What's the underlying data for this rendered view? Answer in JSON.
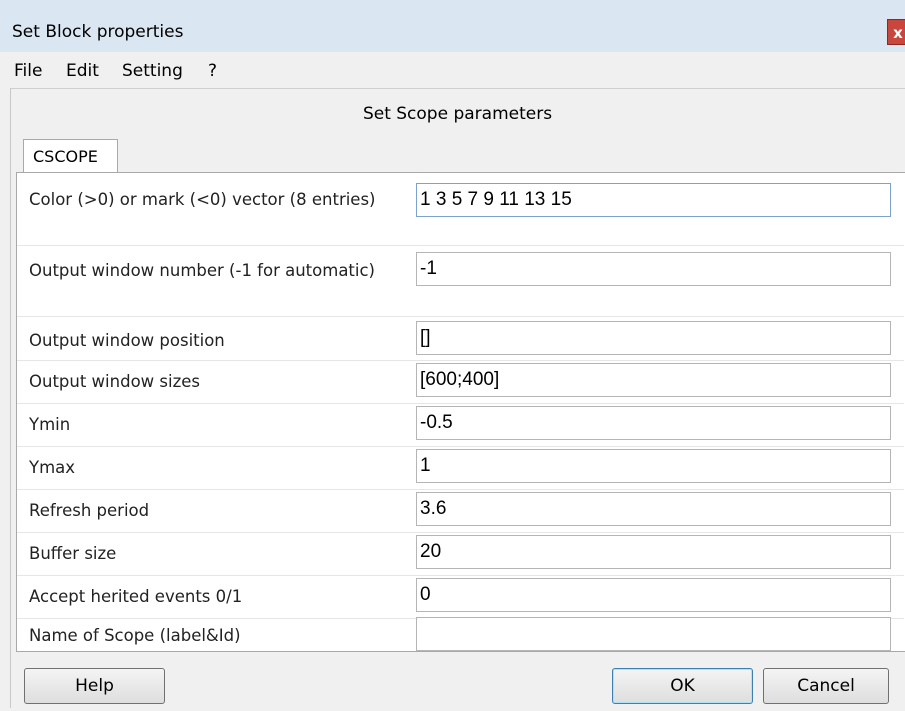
{
  "window": {
    "title": "Set Block properties",
    "close_glyph": "x"
  },
  "menu": [
    "File",
    "Edit",
    "Setting",
    "?"
  ],
  "header": "Set Scope parameters",
  "tab": "CSCOPE",
  "fields": [
    {
      "label": "Color (>0) or mark (<0) vector (8 entries)",
      "value": "1 3 5 7 9 11 13 15"
    },
    {
      "label": "Output window number (-1 for automatic)",
      "value": "-1"
    },
    {
      "label": "Output window position",
      "value": "[]"
    },
    {
      "label": "Output window sizes",
      "value": "[600;400]"
    },
    {
      "label": "Ymin",
      "value": "-0.5"
    },
    {
      "label": "Ymax",
      "value": "1"
    },
    {
      "label": "Refresh period",
      "value": "3.6"
    },
    {
      "label": "Buffer size",
      "value": "20"
    },
    {
      "label": "Accept herited events 0/1",
      "value": "0"
    },
    {
      "label": "Name of Scope (label&Id)",
      "value": ""
    }
  ],
  "buttons": {
    "help": "Help",
    "ok": "OK",
    "cancel": "Cancel"
  }
}
